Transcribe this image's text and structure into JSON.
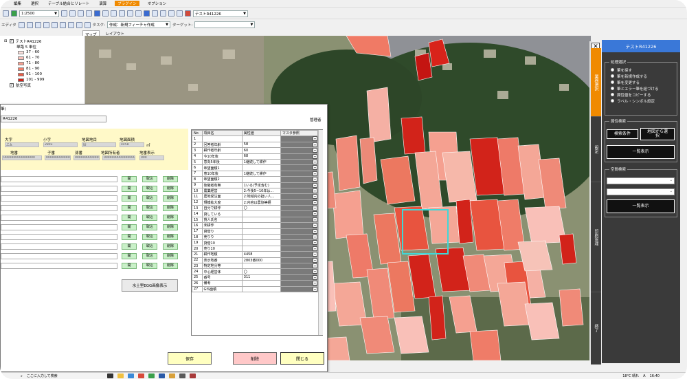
{
  "menu": [
    "編集",
    "選択",
    "テーブル結合とリレート",
    "演算",
    "プラグイン",
    "オプション"
  ],
  "menu_active_index": 4,
  "toolbar": {
    "scale_value": "1:2500",
    "layer_combo": "テストR41226",
    "edit_label": "エディタ",
    "task_label": "タスク:",
    "task_value": "作成：新規フィーチャ作成",
    "target_label": "ターゲット:",
    "target_value": ""
  },
  "view_tabs": [
    "マップ",
    "レイアウト"
  ],
  "layers": {
    "layer_name": "テストR41226",
    "sublabel": "単路 5 単位",
    "legend": [
      {
        "label": "37 - 60",
        "color": "#fbe0dc"
      },
      {
        "label": "61 - 70",
        "color": "#f9c0b8"
      },
      {
        "label": "71 - 80",
        "color": "#f5a091"
      },
      {
        "label": "81 - 90",
        "color": "#ef7c68"
      },
      {
        "label": "91 - 100",
        "color": "#e85a44"
      },
      {
        "label": "101 - 999",
        "color": "#d2231a"
      }
    ],
    "photo_layer": "航空写真"
  },
  "dock": {
    "title": "テストR41226",
    "tabs": [
      "業務選択",
      "設定",
      "印刷管理",
      "終了"
    ],
    "process_group": "処理選択",
    "process_options": [
      "筆を探す",
      "筆を新規作成する",
      "筆を変更する",
      "筆とエラー筆を紐づける",
      "属性値をコピーする",
      "ラベル・シンボル設定"
    ],
    "attr_search_group": "属性検索",
    "search_cond_btn": "検索条件",
    "map_select_btn": "地図から選\n択",
    "list_btn_1": "一覧表示",
    "spatial_search_group": "空間検索",
    "list_btn_2": "一覧表示"
  },
  "dialog": {
    "title": "筆)",
    "code": "R41226",
    "manager": "管理者",
    "yellow_labels": [
      "大字",
      "小字",
      "地図地目",
      "地図面積",
      "地番",
      "子番",
      "孫番",
      "地図所有者",
      "地番表示"
    ],
    "yellow_values": [
      "上五",
      "2803",
      "田",
      "4458",
      "0000000000000000",
      "0000000000000000",
      "0000000000000000",
      "0000000000000000",
      "000"
    ],
    "area_unit": "㎡",
    "row_buttons": [
      "開",
      "取込",
      "削除"
    ],
    "row_count": 10,
    "egg_button": "水土里EGG画像表示",
    "table_headers": [
      "No",
      "項目名",
      "属性値",
      "マスタ参照"
    ],
    "table_rows": [
      [
        "1",
        "",
        ""
      ],
      [
        "2",
        "回答者年齢",
        "58"
      ],
      [
        "3",
        "耕作者年齢",
        "60"
      ],
      [
        "4",
        "今10年後",
        "68"
      ],
      [
        "5",
        "意向5年後",
        "1継続して耕作"
      ],
      [
        "6",
        "希望面積1",
        ""
      ],
      [
        "7",
        "意10年後",
        "1継続して耕作"
      ],
      [
        "8",
        "希望面積2",
        ""
      ],
      [
        "9",
        "後継者有無",
        "1いる(予定含む)"
      ],
      [
        "10",
        "農業経営",
        "2:今後5~10年は..."
      ],
      [
        "11",
        "農地受注面",
        "2:地域内の担い人..."
      ],
      [
        "12",
        "規模拡大度",
        "2:内容は農協等経"
      ],
      [
        "13",
        "自分で耕作",
        "〇"
      ],
      [
        "14",
        "貸している",
        ""
      ],
      [
        "15",
        "貸人氏名",
        ""
      ],
      [
        "16",
        "未耕作",
        ""
      ],
      [
        "17",
        "貸借り",
        ""
      ],
      [
        "18",
        "売りり",
        ""
      ],
      [
        "19",
        "貸借10",
        ""
      ],
      [
        "20",
        "売り10",
        ""
      ],
      [
        "21",
        "耕作地積",
        "4458"
      ],
      [
        "22",
        "表示地番",
        "2803番000"
      ],
      [
        "23",
        "特定地分等",
        ""
      ],
      [
        "24",
        "中心経営体",
        "〇"
      ],
      [
        "25",
        "番号",
        "311"
      ],
      [
        "26",
        "備考",
        ""
      ],
      [
        "27",
        "GIS面積",
        ""
      ]
    ],
    "save_btn": "保存",
    "delete_btn": "削除",
    "close_btn": "閉じる"
  },
  "taskbar": {
    "search_text": "ここに入力して検索",
    "weather": "18°C 晴れ",
    "ime": "A",
    "time": "16:40"
  }
}
